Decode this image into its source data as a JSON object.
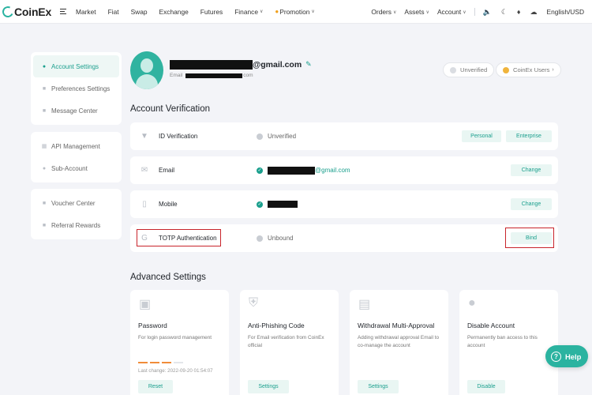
{
  "brand": {
    "name": "CoinEx",
    "accent": "#2bb3a0"
  },
  "nav": {
    "left": [
      {
        "label": "Market"
      },
      {
        "label": "Fiat"
      },
      {
        "label": "Swap"
      },
      {
        "label": "Exchange"
      },
      {
        "label": "Futures"
      },
      {
        "label": "Finance"
      },
      {
        "label": "Promotion"
      }
    ],
    "right": [
      {
        "label": "Orders"
      },
      {
        "label": "Assets"
      },
      {
        "label": "Account"
      }
    ],
    "language": "English/USD"
  },
  "sidebar": {
    "group1": [
      "Account Settings",
      "Preferences Settings",
      "Message Center"
    ],
    "group2": [
      "API Management",
      "Sub-Account"
    ],
    "group3": [
      "Voucher Center",
      "Referral Rewards"
    ]
  },
  "profile": {
    "email_suffix": "@gmail.com",
    "email_label": "Email",
    "email_sub_suffix": "com",
    "verify_status": "Unverified",
    "user_tier": "CoinEx Users"
  },
  "verification": {
    "title": "Account Verification",
    "rows": [
      {
        "label": "ID Verification",
        "status": "Unverified",
        "buttons": [
          "Personal",
          "Enterprise"
        ]
      },
      {
        "label": "Email",
        "status": "@gmail.com",
        "buttons": [
          "Change"
        ]
      },
      {
        "label": "Mobile",
        "status": "",
        "buttons": [
          "Change"
        ]
      },
      {
        "label": "TOTP Authentication",
        "status": "Unbound",
        "buttons": [
          "Bind"
        ]
      }
    ]
  },
  "advanced": {
    "title": "Advanced Settings",
    "cards": [
      {
        "title": "Password",
        "desc": "For login password management",
        "meta": "Last change: 2022-09-20 01:54:07",
        "button": "Reset"
      },
      {
        "title": "Anti-Phishing Code",
        "desc": "For Email verification from CoinEx official",
        "button": "Settings"
      },
      {
        "title": "Withdrawal Multi-Approval",
        "desc": "Adding withdrawal approval Email to co-manage the account",
        "button": "Settings"
      },
      {
        "title": "Disable Account",
        "desc": "Permanently ban access to this account",
        "button": "Disable"
      }
    ]
  },
  "help": {
    "label": "Help"
  }
}
